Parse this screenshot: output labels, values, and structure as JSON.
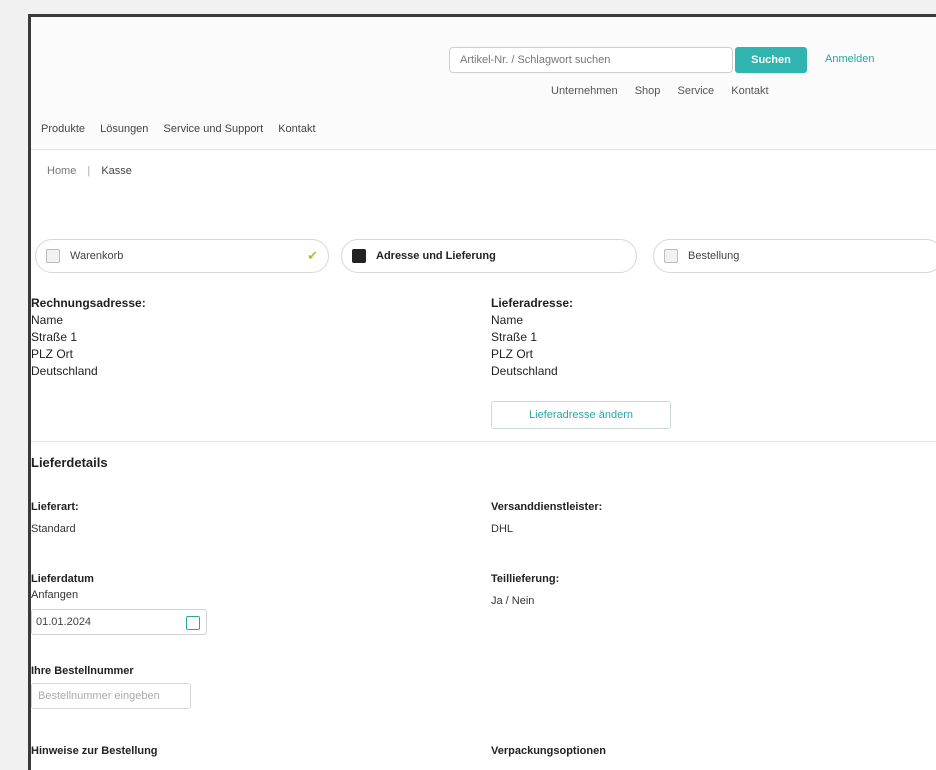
{
  "colors": {
    "accent": "#2fb4b0",
    "link": "#2aa6a2"
  },
  "header": {
    "search_placeholder": "Artikel-Nr. / Schlagwort suchen",
    "search_button": "Suchen",
    "login": "Anmelden",
    "util_nav": [
      "Unternehmen",
      "Shop",
      "Service",
      "Kontakt"
    ],
    "main_nav": [
      "Produkte",
      "Lösungen",
      "Service und Support",
      "Kontakt"
    ]
  },
  "breadcrumb": {
    "home": "Home",
    "current": "Kasse"
  },
  "steps": [
    {
      "label": "Warenkorb",
      "done": true
    },
    {
      "label": "Adresse und Lieferung",
      "done": false
    },
    {
      "label": "Bestellung",
      "done": false
    }
  ],
  "billing": {
    "title": "Rechnungsadresse:",
    "lines": [
      "Name",
      "Straße 1",
      "PLZ Ort",
      "Deutschland"
    ]
  },
  "shipping": {
    "title": "Lieferadresse:",
    "lines": [
      "Name",
      "Straße 1",
      "PLZ Ort",
      "Deutschland"
    ],
    "button": "Lieferadresse ändern"
  },
  "details": {
    "title": "Lieferdetails",
    "mode_label": "Lieferart:",
    "mode_value": "Standard",
    "carrier_label": "Versanddienstleister:",
    "carrier_value": "DHL",
    "date_label": "Lieferdatum",
    "date_sublabel": "Anfangen",
    "date_value": "01.01.2024",
    "partial_label": "Teillieferung:",
    "partial_value": "Ja / Nein",
    "po_label": "Ihre Bestellnummer",
    "po_placeholder": "Bestellnummer eingeben",
    "notes_label": "Hinweise zur Bestellung",
    "right_bottom": "Verpackungsoptionen"
  }
}
